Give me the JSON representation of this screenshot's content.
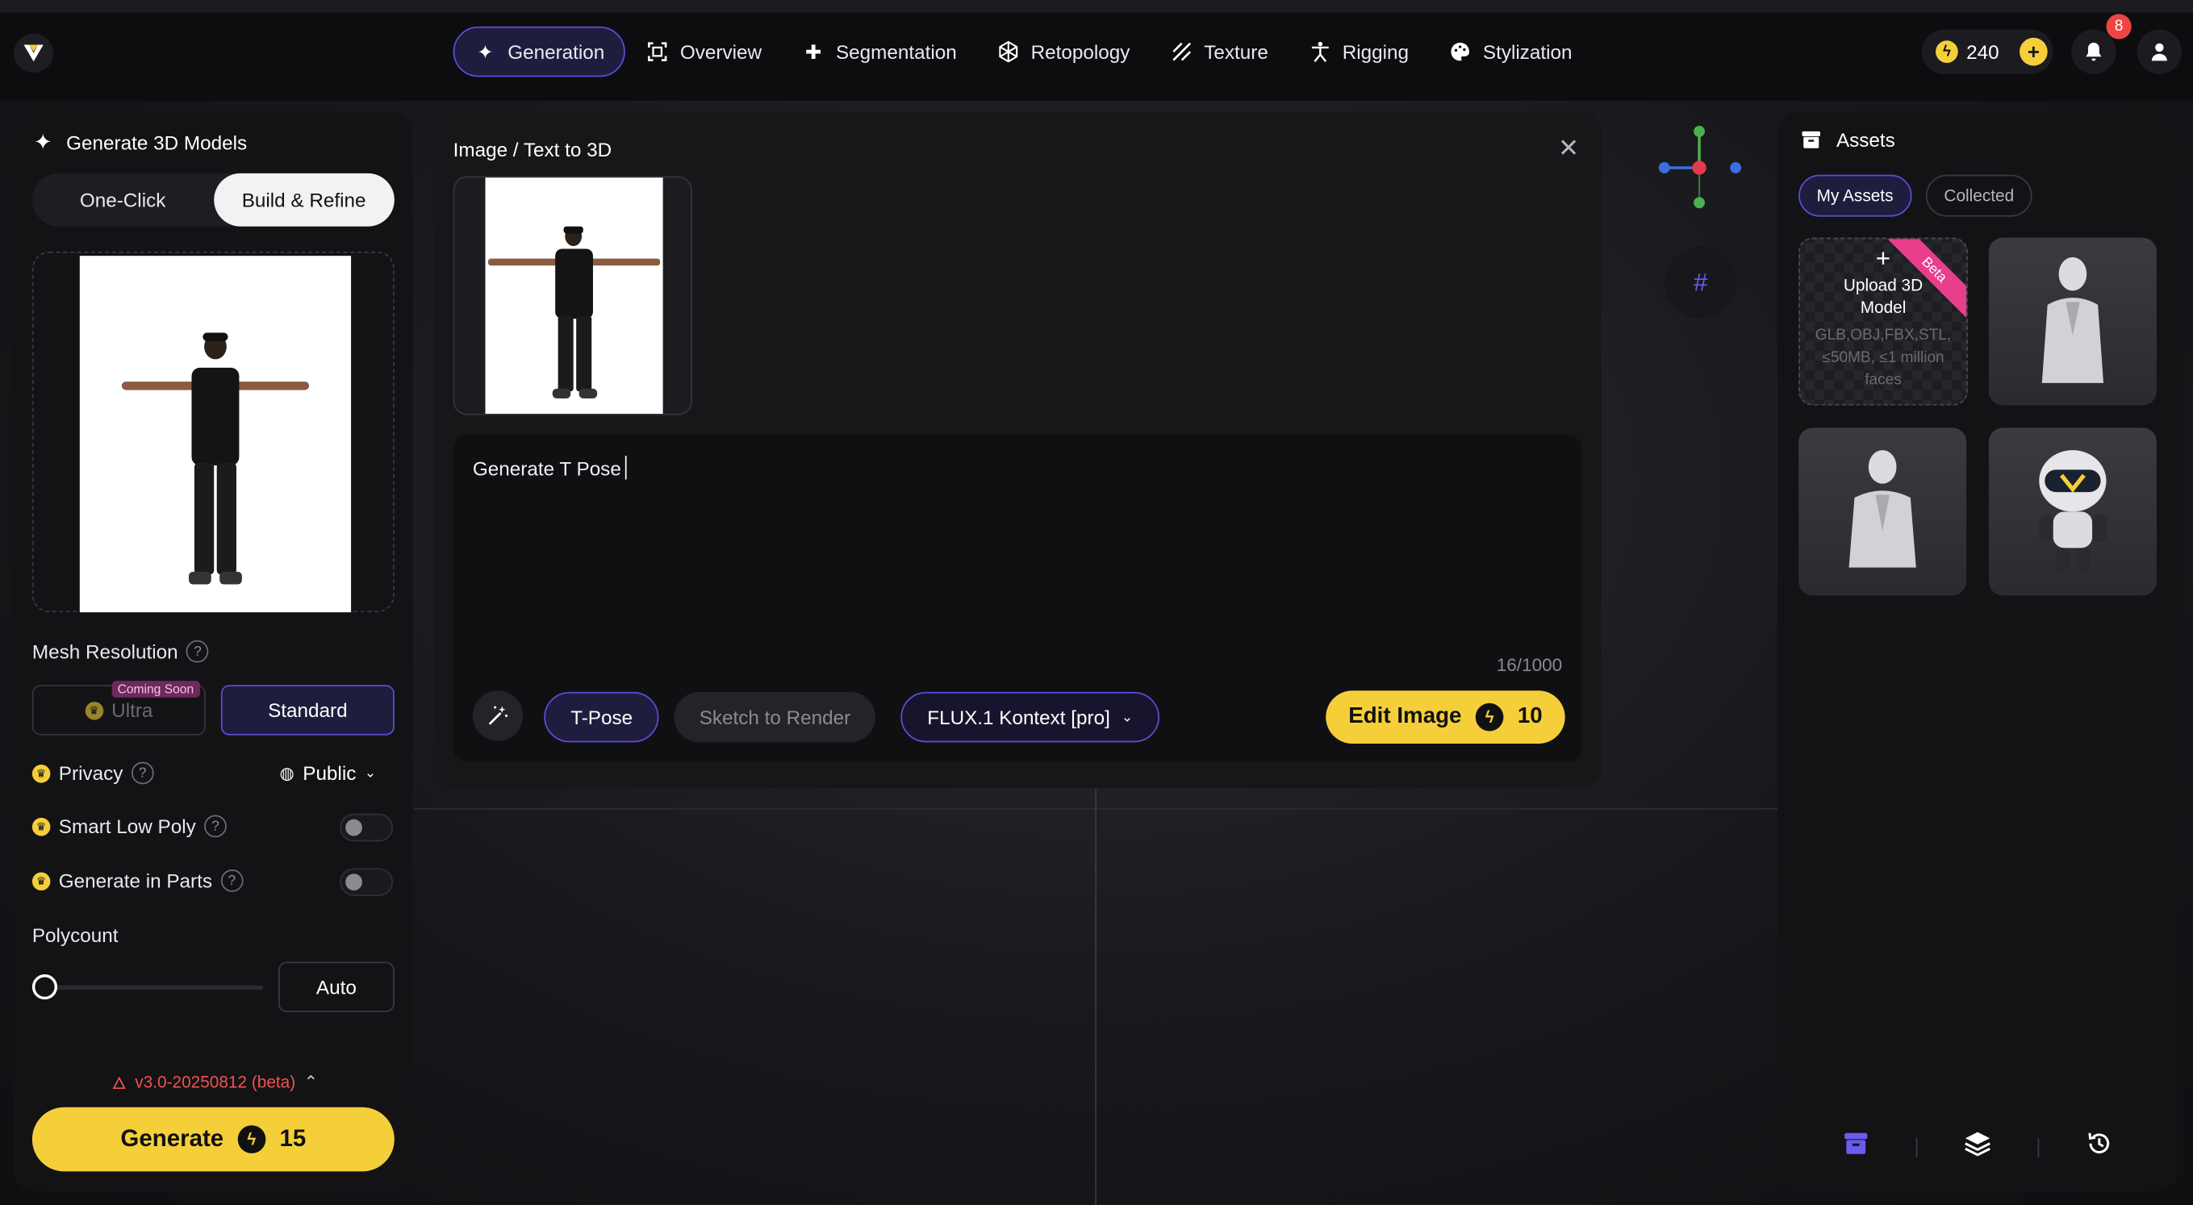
{
  "nav": {
    "items": [
      {
        "label": "Generation",
        "icon": "sparkle-icon",
        "active": true
      },
      {
        "label": "Overview",
        "icon": "scan-icon"
      },
      {
        "label": "Segmentation",
        "icon": "puzzle-icon"
      },
      {
        "label": "Retopology",
        "icon": "polyhedron-icon"
      },
      {
        "label": "Texture",
        "icon": "hatch-icon"
      },
      {
        "label": "Rigging",
        "icon": "figure-icon"
      },
      {
        "label": "Stylization",
        "icon": "palette-icon"
      }
    ],
    "credits": "240",
    "notifications": "8"
  },
  "left": {
    "title": "Generate 3D Models",
    "modes": [
      "One-Click",
      "Build & Refine"
    ],
    "active_mode": "Build & Refine",
    "mesh_resolution_label": "Mesh Resolution",
    "help": "?",
    "ultra_label": "Ultra",
    "coming_soon": "Coming Soon",
    "standard_label": "Standard",
    "privacy_label": "Privacy",
    "privacy_value": "Public",
    "smart_low_poly_label": "Smart Low Poly",
    "generate_in_parts_label": "Generate in Parts",
    "polycount_label": "Polycount",
    "polycount_value": "Auto",
    "version": "v3.0-20250812 (beta)",
    "generate_label": "Generate",
    "generate_cost": "15"
  },
  "center": {
    "title": "Image / Text to 3D",
    "prompt": "Generate T Pose",
    "char_count": "16/1000",
    "chips": [
      "T-Pose",
      "Sketch to Render",
      "FLUX.1 Kontext [pro]"
    ],
    "edit_label": "Edit Image",
    "edit_cost": "10"
  },
  "right": {
    "title": "Assets",
    "tabs": [
      "My Assets",
      "Collected"
    ],
    "upload_title": "Upload 3D Model",
    "upload_hint": "GLB,OBJ,FBX,STL, ≤50MB, ≤1 million faces",
    "beta": "Beta"
  },
  "colors": {
    "accent": "#5a4fd8",
    "yellow": "#f5cf3a",
    "danger": "#ef4444",
    "ribbon": "#e83e8c"
  }
}
